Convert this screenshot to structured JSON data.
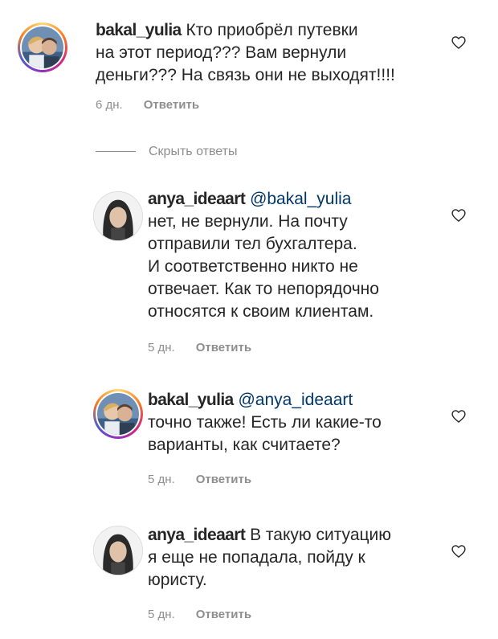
{
  "comments": [
    {
      "username": "bakal_yulia",
      "mention": "",
      "lines": [
        "Кто приобрёл путевки",
        "на этот период??? Вам вернули",
        "деньги??? На связь они не выходят!!!!"
      ],
      "time": "6 дн.",
      "reply_label": "Ответить",
      "avatar": "profile-photo"
    },
    {
      "username": "anya_ideaart",
      "mention": "@bakal_yulia",
      "lines": [
        "",
        "нет, не вернули. На почту",
        "отправили тел бухгалтера.",
        "И соответственно никто не",
        "отвечает. Как то непорядочно",
        "относятся к своим клиентам."
      ],
      "time": "5 дн.",
      "reply_label": "Ответить",
      "avatar": "profile-photo"
    },
    {
      "username": "bakal_yulia",
      "mention": "@anya_ideaart",
      "lines": [
        "",
        "точно также! Есть ли какие-то",
        "варианты, как считаете?"
      ],
      "time": "5 дн.",
      "reply_label": "Ответить",
      "avatar": "profile-photo"
    },
    {
      "username": "anya_ideaart",
      "mention": "",
      "lines": [
        "В такую ситуацию",
        "я еще не попадала, пойду к",
        "юристу."
      ],
      "time": "5 дн.",
      "reply_label": "Ответить",
      "avatar": "profile-photo"
    }
  ],
  "hide_replies_label": "Скрыть ответы",
  "icons": {
    "like": "heart-icon"
  },
  "colors": {
    "text": "#262626",
    "secondary": "#8e8e8e",
    "mention": "#00376b",
    "story_ring": [
      "#feda75",
      "#fa7e1e",
      "#d62976",
      "#962fbf",
      "#4f5bd5"
    ]
  }
}
